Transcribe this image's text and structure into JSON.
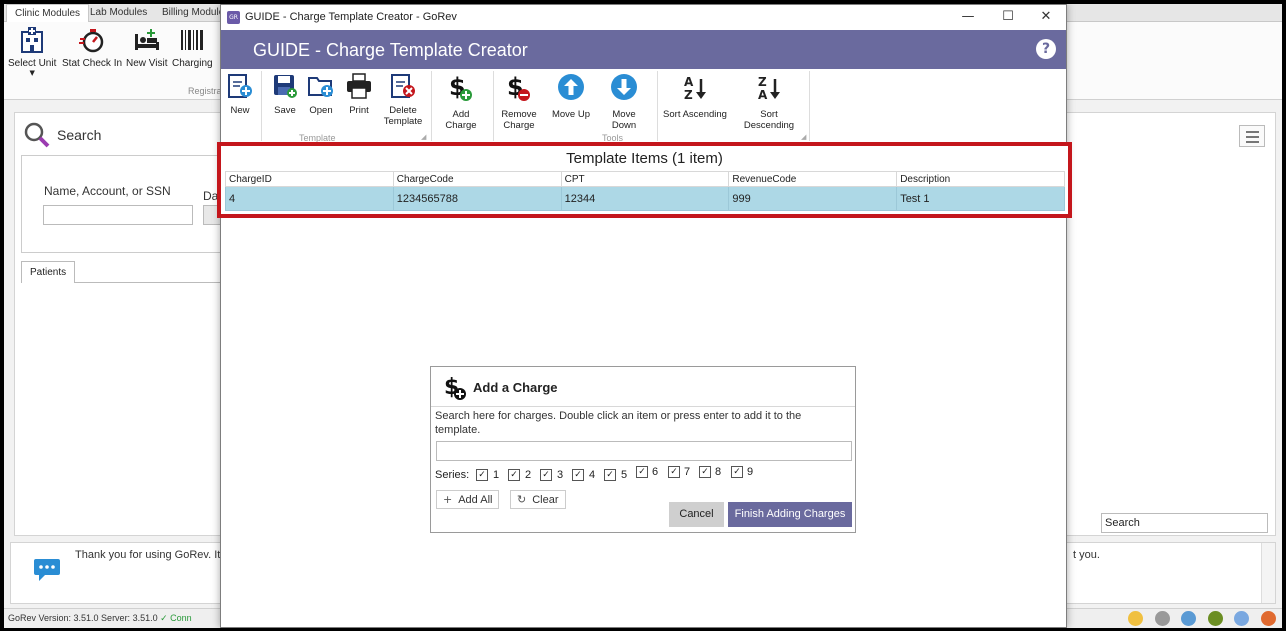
{
  "bg": {
    "tabs": [
      "Clinic Modules",
      "Lab Modules",
      "Billing Modules"
    ],
    "ribbon_buttons": [
      "Select Unit",
      "Stat Check In",
      "New Visit",
      "Charging"
    ],
    "ribbon_group": "Registra",
    "search_title": "Search",
    "name_label": "Name, Account, or SSN",
    "date_label": "Dat",
    "patients_tab": "Patients",
    "right_search_value": "Search",
    "message": "Thank you for using GoRev.  It",
    "message_tail": "t you.",
    "status_version": "GoRev Version: 3.51.0   Server: 3.51.0",
    "status_conn": "✓ Conn"
  },
  "window": {
    "title": "GUIDE - Charge Template Creator - GoRev",
    "minimize": "—",
    "maximize": "☐",
    "close": "✕",
    "header": "GUIDE - Charge Template Creator",
    "help": "?"
  },
  "toolbar": {
    "new": "New",
    "save": "Save",
    "open": "Open",
    "print": "Print",
    "delete": [
      "Delete",
      "Template"
    ],
    "add_charge": "Add Charge",
    "remove_charge": [
      "Remove",
      "Charge"
    ],
    "move_up": "Move Up",
    "move_down": "Move Down",
    "sort_asc": "Sort Ascending",
    "sort_desc": "Sort Descending",
    "group_template": "Template",
    "group_tools": "Tools"
  },
  "template_items": {
    "title": "Template Items (1 item)",
    "columns": [
      "ChargeID",
      "ChargeCode",
      "CPT",
      "RevenueCode",
      "Description"
    ],
    "rows": [
      [
        "4",
        "1234565788",
        "12344",
        "999",
        "Test 1"
      ]
    ]
  },
  "dialog": {
    "title": "Add a Charge",
    "help": "Search here for charges. Double click an item or press enter to add it to the template.",
    "search_value": "",
    "series_label": "Series:",
    "series": [
      "1",
      "2",
      "3",
      "4",
      "5",
      "6",
      "7",
      "8",
      "9"
    ],
    "add_all": "Add All",
    "clear": "Clear",
    "cancel": "Cancel",
    "finish": "Finish Adding Charges"
  },
  "colors": {
    "header": "#6a6a9e",
    "highlight": "#c4161c",
    "row_selected": "#add8e6"
  }
}
